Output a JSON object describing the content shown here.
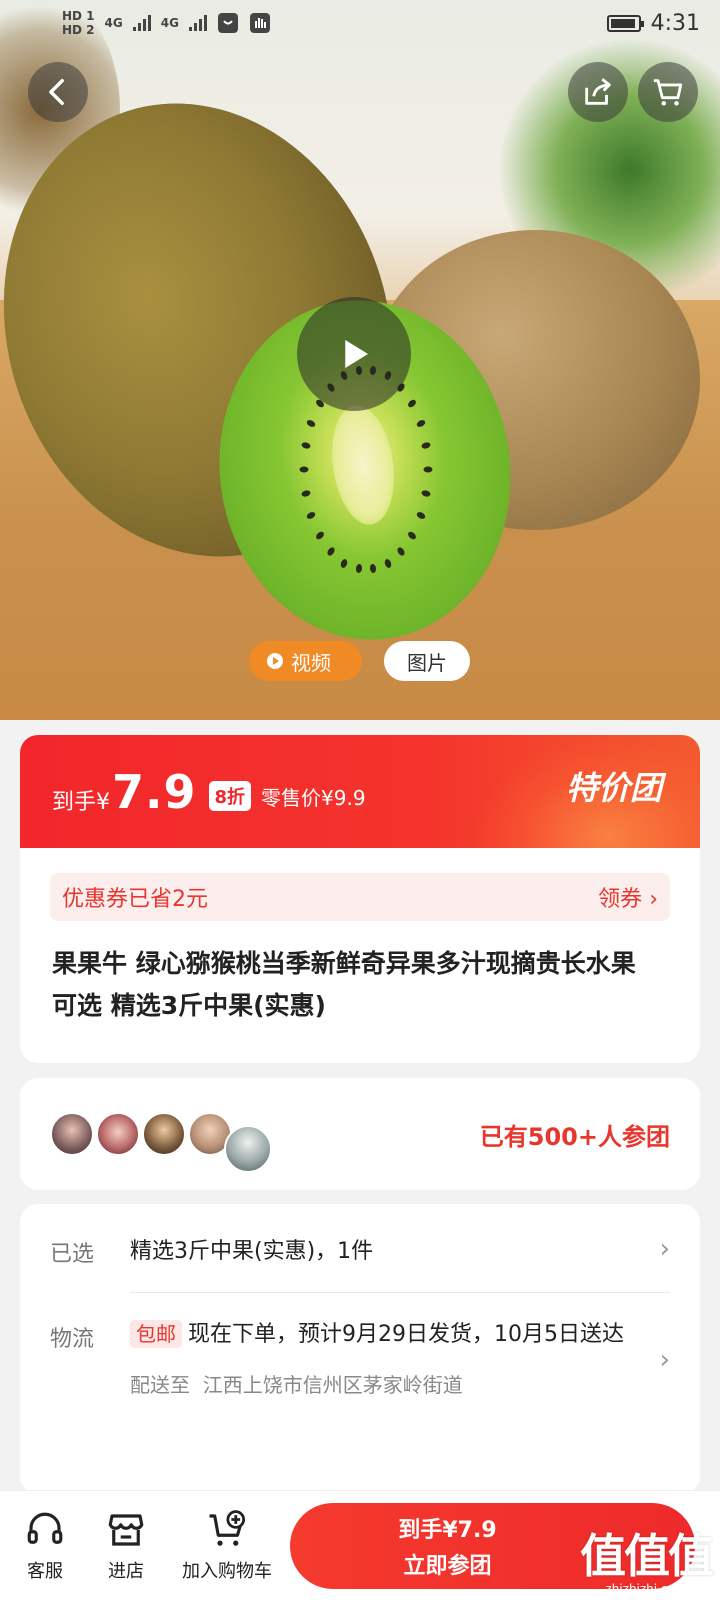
{
  "status_bar": {
    "sim1": "HD 1",
    "sim2": "HD 2",
    "network1": "4G",
    "network2": "4G",
    "time": "4:31"
  },
  "hero": {
    "tabs": {
      "video": "视频",
      "photo": "图片"
    }
  },
  "price": {
    "prefix": "到手¥",
    "value": "7.9",
    "discount": "8折",
    "retail": "零售价¥9.9",
    "badge": "特价团"
  },
  "coupon": {
    "text": "优惠券已省2元",
    "action": "领券"
  },
  "product": {
    "title": "果果牛 绿心猕猴桃当季新鲜奇异果多汁现摘贵长水果 可选 精选3斤中果(实惠)"
  },
  "group": {
    "count_text": "已有500+人参团"
  },
  "info": {
    "selected_label": "已选",
    "selected_value": "精选3斤中果(实惠)，1件",
    "logistics_label": "物流",
    "free_shipping": "包邮",
    "logistics_value": "现在下单，预计9月29日发货，10月5日送达",
    "ship_to_label": "配送至",
    "ship_to_value": "江西上饶市信州区茅家岭街道"
  },
  "bottom_bar": {
    "service": "客服",
    "store": "进店",
    "add_cart": "加入购物车",
    "buy_price": "到手¥7.9",
    "buy_label": "立即参团"
  },
  "watermark": {
    "big": "值值值",
    "small": "zhizhizhi.com"
  },
  "colors": {
    "accent": "#f2262b",
    "video_tab": "#f08a24"
  }
}
